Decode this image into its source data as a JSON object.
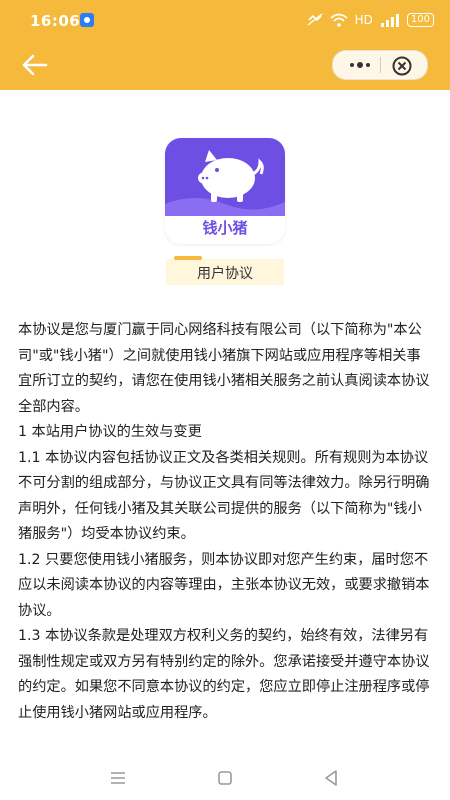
{
  "status": {
    "time": "16:06",
    "network": "HD",
    "battery": "100"
  },
  "page": {
    "app_name": "钱小猪",
    "section_title": "用户协议"
  },
  "content": {
    "paragraphs": [
      "本协议是您与厦门赢于同心网络科技有限公司（以下简称为\"本公司\"或\"钱小猪\"）之间就使用钱小猪旗下网站或应用程序等相关事宜所订立的契约，请您在使用钱小猪相关服务之前认真阅读本协议全部内容。",
      "1 本站用户协议的生效与变更",
      "1.1 本协议内容包括协议正文及各类相关规则。所有规则为本协议不可分割的组成部分，与协议正文具有同等法律效力。除另行明确声明外，任何钱小猪及其关联公司提供的服务（以下简称为\"钱小猪服务\"）均受本协议约束。",
      "1.2 只要您使用钱小猪服务，则本协议即对您产生约束，届时您不应以未阅读本协议的内容等理由，主张本协议无效，或要求撤销本协议。",
      "1.3 本协议条款是处理双方权利义务的契约，始终有效，法律另有强制性规定或双方另有特别约定的除外。您承诺接受并遵守本协议的约定。如果您不同意本协议的约定，您应立即停止注册程序或停止使用钱小猪网站或应用程序。"
    ]
  },
  "colors": {
    "header_bg": "#F5B93B",
    "logo_purple": "#6E4FE3",
    "pill_bg": "#FFF6DC"
  },
  "icons": {
    "back": "arrow-left-icon",
    "more": "more-dots-icon",
    "close": "close-circle-icon",
    "nav_menu": "menu-icon",
    "nav_home": "square-icon",
    "nav_back": "triangle-back-icon"
  }
}
